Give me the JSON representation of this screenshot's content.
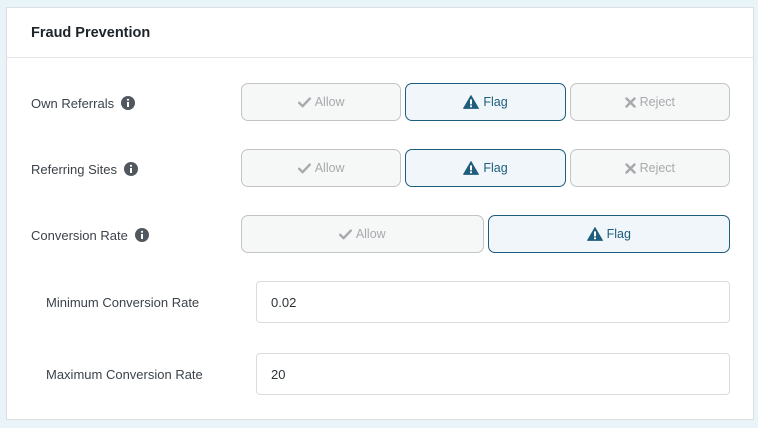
{
  "panel": {
    "title": "Fraud Prevention"
  },
  "rows": [
    {
      "label": "Own Referrals",
      "options": [
        {
          "label": "Allow",
          "icon": "check-icon",
          "selected": false
        },
        {
          "label": "Flag",
          "icon": "warning-icon",
          "selected": true
        },
        {
          "label": "Reject",
          "icon": "x-icon",
          "selected": false
        }
      ]
    },
    {
      "label": "Referring Sites",
      "options": [
        {
          "label": "Allow",
          "icon": "check-icon",
          "selected": false
        },
        {
          "label": "Flag",
          "icon": "warning-icon",
          "selected": true
        },
        {
          "label": "Reject",
          "icon": "x-icon",
          "selected": false
        }
      ]
    },
    {
      "label": "Conversion Rate",
      "options": [
        {
          "label": "Allow",
          "icon": "check-icon",
          "selected": false
        },
        {
          "label": "Flag",
          "icon": "warning-icon",
          "selected": true
        }
      ]
    }
  ],
  "conversion": {
    "min_label": "Minimum Conversion Rate",
    "min_value": "0.02",
    "max_label": "Maximum Conversion Rate",
    "max_value": "20"
  },
  "colors": {
    "accent": "#1e5e7c",
    "disabled_text": "#a7aaad",
    "info_icon": "#50575e",
    "background": "#e8f4f7"
  }
}
